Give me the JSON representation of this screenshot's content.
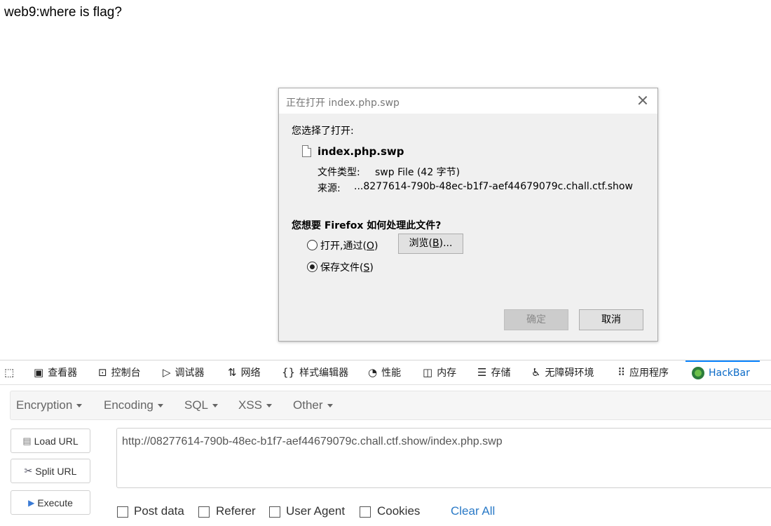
{
  "page": {
    "heading": "web9:where is flag?"
  },
  "dialog": {
    "title": "正在打开 index.php.swp",
    "intro": "您选择了打开:",
    "filename": "index.php.swp",
    "type_label": "文件类型:",
    "type_value": "swp File (42 字节)",
    "source_label": "来源:",
    "source_value": "...8277614-790b-48ec-b1f7-aef44679079c.chall.ctf.show",
    "question": "您想要 Firefox 如何处理此文件?",
    "option_open": {
      "label": "打开,通过(",
      "key": "O",
      "suffix": ")",
      "checked": false
    },
    "browse_button": {
      "label": "浏览(",
      "key": "B",
      "suffix": ")..."
    },
    "option_save": {
      "label": "保存文件(",
      "key": "S",
      "suffix": ")",
      "checked": true
    },
    "ok_button": "确定",
    "cancel_button": "取消"
  },
  "devtools": {
    "tabs": [
      {
        "label": "查看器",
        "icon": "inspector-icon"
      },
      {
        "label": "控制台",
        "icon": "console-icon"
      },
      {
        "label": "调试器",
        "icon": "debugger-icon"
      },
      {
        "label": "网络",
        "icon": "network-icon"
      },
      {
        "label": "样式编辑器",
        "icon": "style-editor-icon"
      },
      {
        "label": "性能",
        "icon": "performance-icon"
      },
      {
        "label": "内存",
        "icon": "memory-icon"
      },
      {
        "label": "存储",
        "icon": "storage-icon"
      },
      {
        "label": "无障碍环境",
        "icon": "accessibility-icon"
      },
      {
        "label": "应用程序",
        "icon": "application-icon"
      },
      {
        "label": "HackBar",
        "icon": "hackbar-icon",
        "active": true
      }
    ]
  },
  "hackbar": {
    "menus": [
      "Encryption",
      "Encoding",
      "SQL",
      "XSS",
      "Other"
    ],
    "buttons": {
      "load": "Load URL",
      "split": "Split URL",
      "execute": "Execute"
    },
    "url": "http://08277614-790b-48ec-b1f7-aef44679079c.chall.ctf.show/index.php.swp",
    "checkboxes": [
      "Post data",
      "Referer",
      "User Agent",
      "Cookies"
    ],
    "clear_all": "Clear All"
  }
}
